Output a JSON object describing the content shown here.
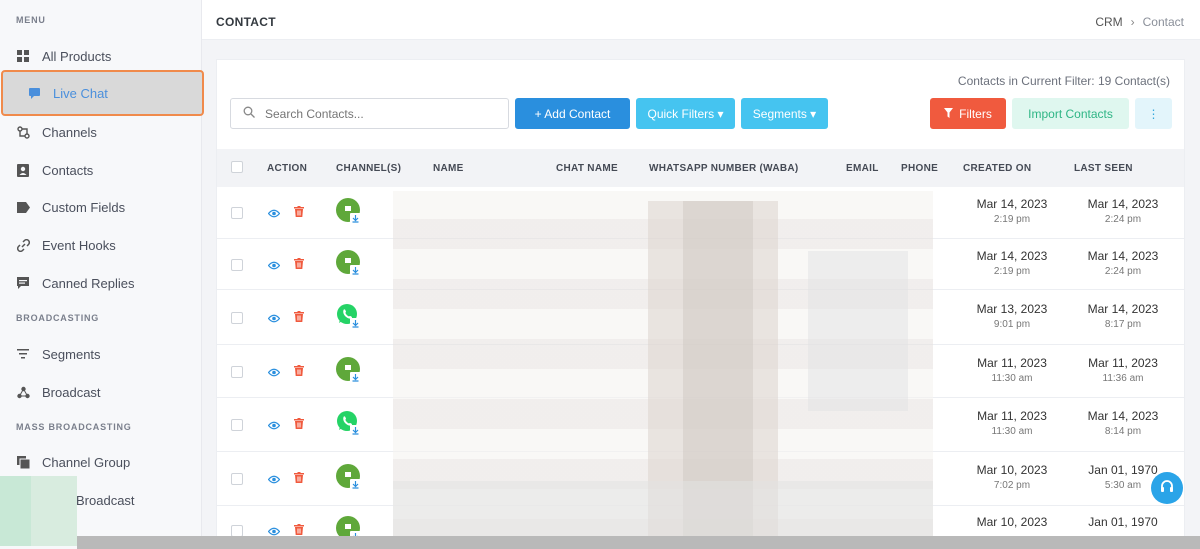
{
  "sidebar": {
    "sections": [
      "MENU",
      "BROADCASTING",
      "MASS BROADCASTING"
    ],
    "items": [
      {
        "label": "All Products",
        "icon": "grid-icon"
      },
      {
        "label": "Live Chat",
        "icon": "chat-icon"
      },
      {
        "label": "Channels",
        "icon": "channels-icon"
      },
      {
        "label": "Contacts",
        "icon": "contacts-icon"
      },
      {
        "label": "Custom Fields",
        "icon": "tag-icon"
      },
      {
        "label": "Event Hooks",
        "icon": "link-icon"
      },
      {
        "label": "Canned Replies",
        "icon": "message-icon"
      },
      {
        "label": "Segments",
        "icon": "filter-lines-icon"
      },
      {
        "label": "Broadcast",
        "icon": "broadcast-icon"
      },
      {
        "label": "Channel Group",
        "icon": "stack-icon"
      },
      {
        "label": "Broadcast",
        "icon": "broadcast-icon"
      }
    ]
  },
  "header": {
    "title": "CONTACT",
    "breadcrumb": [
      "CRM",
      "Contact"
    ]
  },
  "toolbar": {
    "count_text": "Contacts in Current Filter: 19 Contact(s)",
    "search_placeholder": "Search Contacts...",
    "add_label": "+ Add Contact",
    "quick_label": "Quick Filters ▾",
    "segments_label": "Segments ▾",
    "filters_label": "Filters",
    "import_label": "Import Contacts",
    "more_label": "⋮"
  },
  "table": {
    "columns": [
      "ACTION",
      "CHANNEL(S)",
      "NAME",
      "CHAT NAME",
      "WHATSAPP NUMBER (WABA)",
      "EMAIL",
      "PHONE",
      "CREATED ON",
      "LAST SEEN"
    ],
    "rows": [
      {
        "channel": "livechat",
        "created_date": "Mar 14, 2023",
        "created_time": "2:19 pm",
        "seen_date": "Mar 14, 2023",
        "seen_time": "2:24 pm"
      },
      {
        "channel": "livechat",
        "created_date": "Mar 14, 2023",
        "created_time": "2:19 pm",
        "seen_date": "Mar 14, 2023",
        "seen_time": "2:24 pm"
      },
      {
        "channel": "whatsapp",
        "created_date": "Mar 13, 2023",
        "created_time": "9:01 pm",
        "seen_date": "Mar 14, 2023",
        "seen_time": "8:17 pm"
      },
      {
        "channel": "livechat",
        "created_date": "Mar 11, 2023",
        "created_time": "11:30 am",
        "seen_date": "Mar 11, 2023",
        "seen_time": "11:36 am"
      },
      {
        "channel": "whatsapp",
        "created_date": "Mar 11, 2023",
        "created_time": "11:30 am",
        "seen_date": "Mar 14, 2023",
        "seen_time": "8:14 pm"
      },
      {
        "channel": "livechat",
        "created_date": "Mar 10, 2023",
        "created_time": "7:02 pm",
        "seen_date": "Jan 01, 1970",
        "seen_time": "5:30 am"
      },
      {
        "channel": "livechat",
        "created_date": "Mar 10, 2023",
        "created_time": "",
        "seen_date": "Jan 01, 1970",
        "seen_time": ""
      }
    ]
  },
  "colors": {
    "accent": "#2a8fde",
    "active_border": "#f08a4b",
    "danger": "#f05a3e",
    "whatsapp": "#25d366",
    "livechat": "#5fa83a"
  }
}
